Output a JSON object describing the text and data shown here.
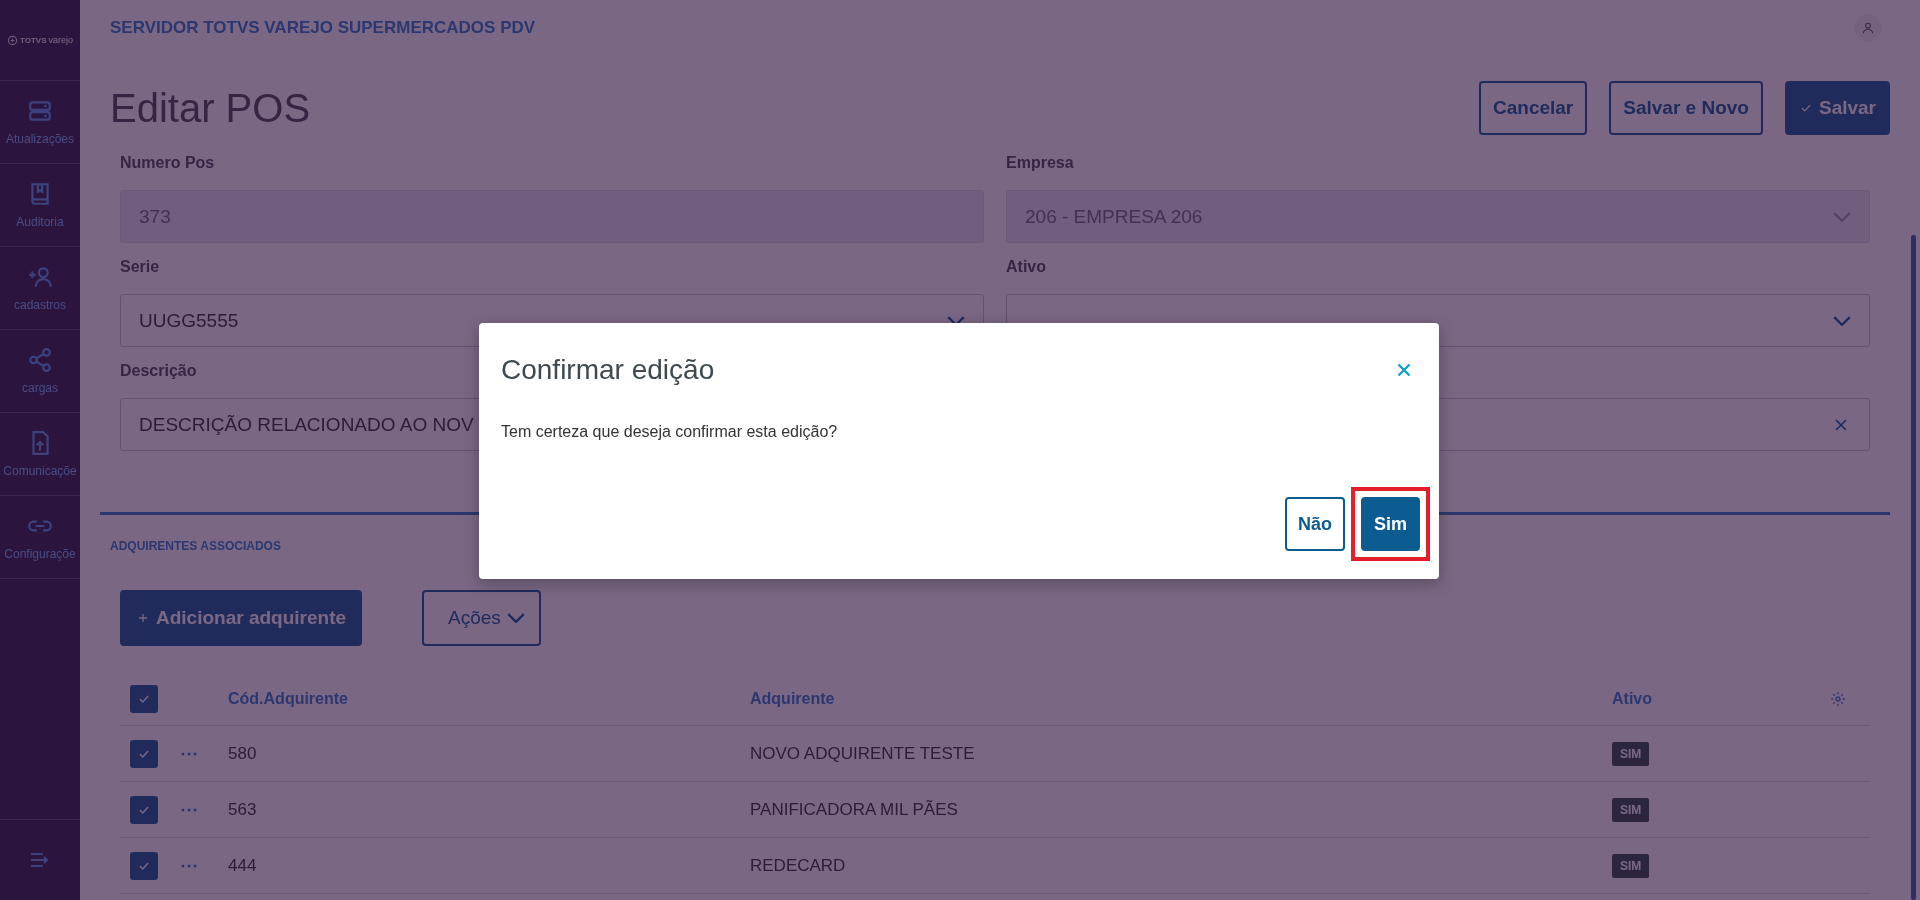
{
  "sidebar": {
    "logo": {
      "brand": "TOTVS",
      "product": "varejo"
    },
    "items": [
      {
        "label": "Atualizações"
      },
      {
        "label": "Auditoria"
      },
      {
        "label": "cadastros"
      },
      {
        "label": "cargas"
      },
      {
        "label": "Comunicaçõe"
      },
      {
        "label": "Configuraçõe"
      }
    ]
  },
  "header": {
    "title": "SERVIDOR TOTVS VAREJO SUPERMERCADOS PDV"
  },
  "page": {
    "title": "Editar POS",
    "actions": [
      {
        "label": "Cancelar",
        "kind": "secondary"
      },
      {
        "label": "Salvar e Novo",
        "kind": "secondary"
      },
      {
        "label": "Salvar",
        "kind": "primary"
      }
    ]
  },
  "form": {
    "fields": [
      {
        "label": "Numero Pos",
        "value": "373",
        "kind": "text",
        "disabled": true
      },
      {
        "label": "Empresa",
        "value": "206 - EMPRESA 206",
        "kind": "select",
        "disabled": true
      },
      {
        "label": "Serie",
        "value": "UUGG5555",
        "kind": "select",
        "disabled": false
      },
      {
        "label": "Ativo",
        "kind": "select",
        "disabled": false
      },
      {
        "label": "Descrição",
        "value": "DESCRIÇÃO RELACIONADO AO NOV",
        "kind": "clearable",
        "disabled": false
      }
    ]
  },
  "section": {
    "title": "ADQUIRENTES ASSOCIADOS",
    "add_button": "Adicionar adquirente",
    "actions_button": "Ações"
  },
  "table": {
    "all_checked": true,
    "columns": [
      "Cód.Adquirente",
      "Adquirente",
      "Ativo"
    ],
    "rows": [
      {
        "checked": true,
        "code": "580",
        "name": "NOVO ADQUIRENTE TESTE",
        "active": "SIM"
      },
      {
        "checked": true,
        "code": "563",
        "name": "PANIFICADORA MIL PÃES",
        "active": "SIM"
      },
      {
        "checked": true,
        "code": "444",
        "name": "REDECARD",
        "active": "SIM"
      }
    ]
  },
  "dialog": {
    "title": "Confirmar edição",
    "message": "Tem certeza que deseja confirmar esta edição?",
    "buttons": [
      {
        "label": "Não",
        "kind": "secondary",
        "highlighted": false
      },
      {
        "label": "Sim",
        "kind": "primary",
        "highlighted": true
      }
    ]
  }
}
